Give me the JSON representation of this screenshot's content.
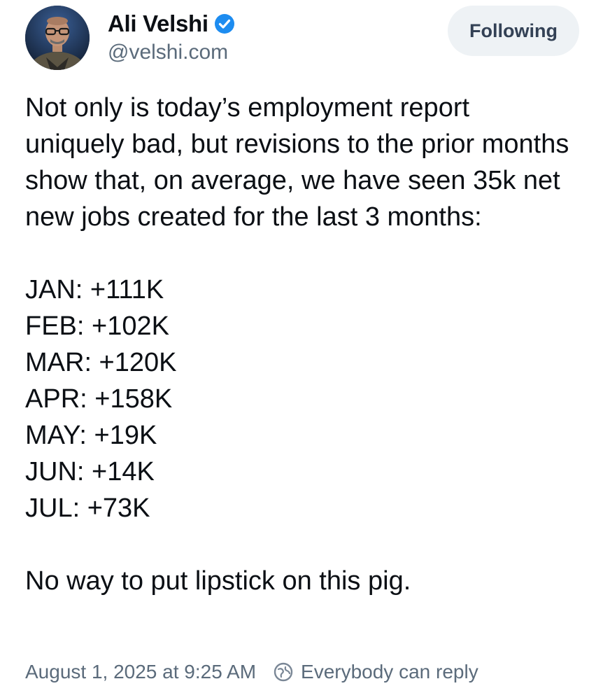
{
  "author": {
    "display_name": "Ali Velshi",
    "handle": "@velshi.com",
    "verified": true,
    "verified_color": "#1d8cf0"
  },
  "follow_button": {
    "label": "Following"
  },
  "post": {
    "intro": "Not only is today’s employment report uniquely bad, but revisions to the prior months show that, on average, we have seen 35k net new jobs created for the last 3 months:",
    "jobs": [
      "JAN: +111K",
      "FEB: +102K",
      "MAR: +120K",
      "APR: +158K",
      "MAY: +19K",
      "JUN: +14K",
      "JUL: +73K"
    ],
    "closing": "No way to put lipstick on this pig."
  },
  "meta": {
    "timestamp": "August 1, 2025 at 9:25 AM",
    "reply_setting": "Everybody can reply"
  },
  "icons": {
    "verified": "verified-badge-icon",
    "reply": "globe-reply-icon"
  }
}
